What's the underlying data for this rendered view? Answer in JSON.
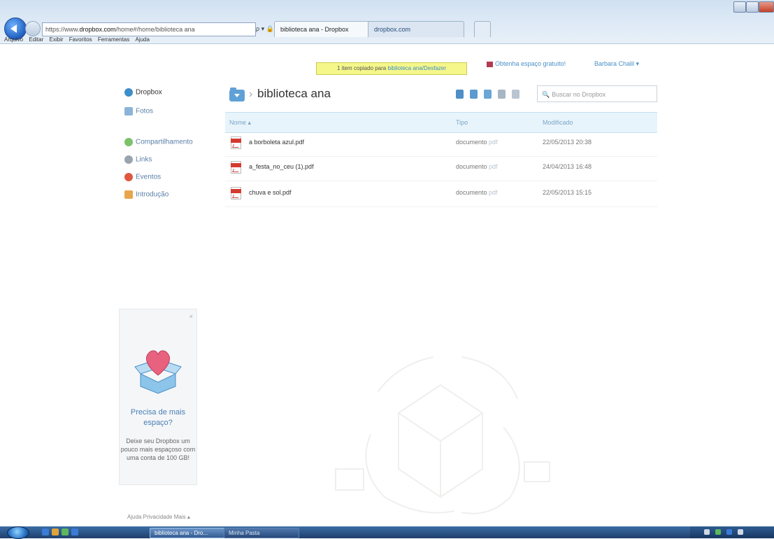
{
  "browser": {
    "address_prefix": "https://www.",
    "address_domain": "dropbox.com",
    "address_path": "/home#/home/biblioteca ana",
    "address_icons": "ρ ▾ 🔒 ≣ C ✕",
    "tabs": [
      {
        "label": "biblioteca ana - Dropbox",
        "close": "×"
      },
      {
        "label": "dropbox.com"
      }
    ],
    "menu": [
      "Arquivo",
      "Editar",
      "Exibir",
      "Favoritos",
      "Ferramentas",
      "Ajuda"
    ]
  },
  "banner": {
    "notice_prefix": "1 item copiado para ",
    "notice_link": "biblioteca ana/Desfazer",
    "gift_label": "Obtenha espaço gratuito!",
    "user_label": "Barbara Chalil ▾"
  },
  "sidebar": {
    "items": [
      {
        "label": "Dropbox"
      },
      {
        "label": "Fotos"
      },
      {
        "label": "Compartilhamento"
      },
      {
        "label": "Links"
      },
      {
        "label": "Eventos"
      },
      {
        "label": "Introdução"
      }
    ]
  },
  "main": {
    "breadcrumb_sep": "›",
    "folder_title": "biblioteca ana",
    "search_placeholder": "Buscar no Dropbox",
    "search_icon": "🔍",
    "columns": {
      "name": "Nome ▴",
      "type": "Tipo",
      "modified": "Modificado"
    },
    "files": [
      {
        "name": "a borboleta azul.pdf",
        "type": "documento",
        "ext": "pdf",
        "modified": "22/05/2013 20:38"
      },
      {
        "name": "a_festa_no_ceu (1).pdf",
        "type": "documento",
        "ext": "pdf",
        "modified": "24/04/2013 16:48"
      },
      {
        "name": "chuva e sol.pdf",
        "type": "documento",
        "ext": "pdf",
        "modified": "22/05/2013 15:15"
      }
    ]
  },
  "promo": {
    "close": "×",
    "title": "Precisa de mais espaço?",
    "text": "Deixe seu Dropbox um pouco mais espaçoso com uma conta de 100 GB!"
  },
  "footer": {
    "text": "Ajuda   Privacidade   Mais ▴"
  },
  "taskbar": {
    "buttons": [
      {
        "label": "biblioteca ana - Dro..."
      },
      {
        "label": "Minha Pasta"
      }
    ]
  },
  "colors": {
    "accent": "#3d8ec9",
    "table_header_bg": "#e8f4fb",
    "notice_bg": "#f5f78a",
    "taskbar": "#1f3f6e"
  }
}
